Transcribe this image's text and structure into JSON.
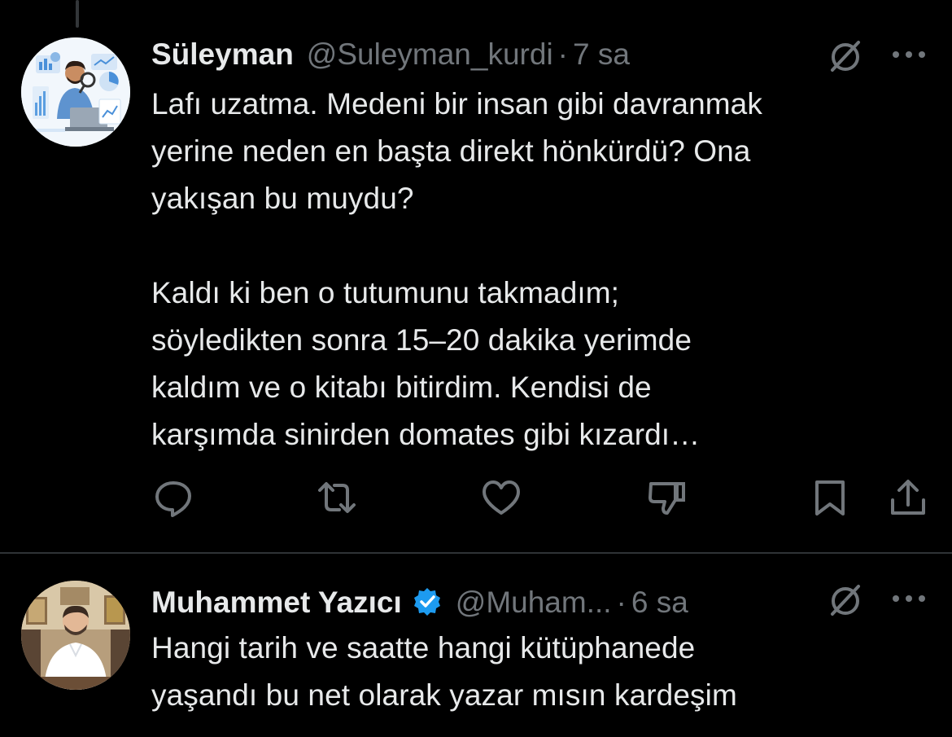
{
  "colors": {
    "background": "#000000",
    "primary_text": "#e7e9ea",
    "secondary_text": "#71767b",
    "divider": "#2f3336",
    "verified_blue": "#1d9bf0"
  },
  "tweets": [
    {
      "name": "Süleyman",
      "handle": "@Suleyman_kurdi",
      "separator": "·",
      "time": "7 sa",
      "text": "Lafı uzatma. Medeni bir insan gibi davranmak\nyerine neden en başta direkt hönkürdü? Ona\nyakışan bu muydu?\n\nKaldı ki ben o tutumunu takmadım;\nsöyledikten sonra 15–20 dakika yerimde\nkaldım ve o kitabı bitirdim. Kendisi de\nkarşımda sinirden domates gibi kızardı…",
      "verified": false,
      "actions": [
        "reply-icon",
        "repost-icon",
        "like-icon",
        "dislike-icon",
        "bookmark-icon",
        "share-icon"
      ]
    },
    {
      "name": "Muhammet Yazıcı",
      "handle": "@Muham...",
      "separator": "·",
      "time": "6 sa",
      "text": "Hangi tarih ve saatte hangi kütüphanede\nyaşandı bu net olarak yazar mısın kardeşim",
      "verified": true
    }
  ]
}
